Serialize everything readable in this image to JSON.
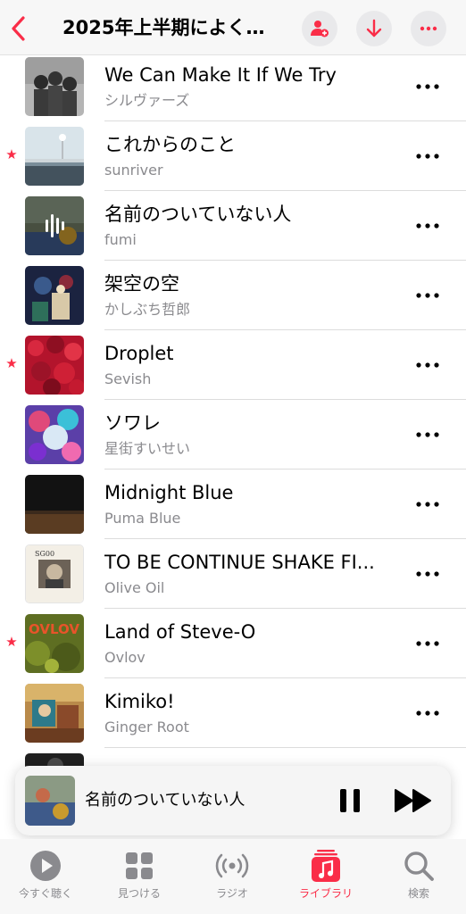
{
  "header": {
    "title": "2025年上半期によく…",
    "back_icon": "chevron-left-icon",
    "add_user_icon": "person-add-icon",
    "download_icon": "arrow-down-icon",
    "more_icon": "ellipsis-icon",
    "accent_color": "#fa2d48"
  },
  "songs": [
    {
      "title": "We Can Make It If We Try",
      "artist": "シルヴァーズ",
      "favorite": false
    },
    {
      "title": "これからのこと",
      "artist": "sunriver",
      "favorite": true
    },
    {
      "title": "名前のついていない人",
      "artist": "fumi",
      "favorite": false,
      "now_playing": true
    },
    {
      "title": "架空の空",
      "artist": "かしぶち哲郎",
      "favorite": false
    },
    {
      "title": "Droplet",
      "artist": "Sevish",
      "favorite": true
    },
    {
      "title": "ソワレ",
      "artist": "星街すいせい",
      "favorite": false
    },
    {
      "title": "Midnight Blue",
      "artist": "Puma Blue",
      "favorite": false
    },
    {
      "title": "TO BE CONTINUE SHAKE FI...",
      "artist": "Olive Oil",
      "favorite": false
    },
    {
      "title": "Land of Steve-O",
      "artist": "Ovlov",
      "favorite": true
    },
    {
      "title": "Kimiko!",
      "artist": "Ginger Root",
      "favorite": false
    }
  ],
  "art_labels": {
    "ovlov": "OVLOV",
    "olive": "SG00"
  },
  "mini_player": {
    "title": "名前のついていない人",
    "pause_icon": "pause-icon",
    "forward_icon": "fast-forward-icon"
  },
  "tabs": [
    {
      "label": "今すぐ聴く",
      "icon": "play-circle-icon",
      "active": false
    },
    {
      "label": "見つける",
      "icon": "grid-icon",
      "active": false
    },
    {
      "label": "ラジオ",
      "icon": "radio-icon",
      "active": false
    },
    {
      "label": "ライブラリ",
      "icon": "music-library-icon",
      "active": true
    },
    {
      "label": "検索",
      "icon": "search-icon",
      "active": false
    }
  ]
}
